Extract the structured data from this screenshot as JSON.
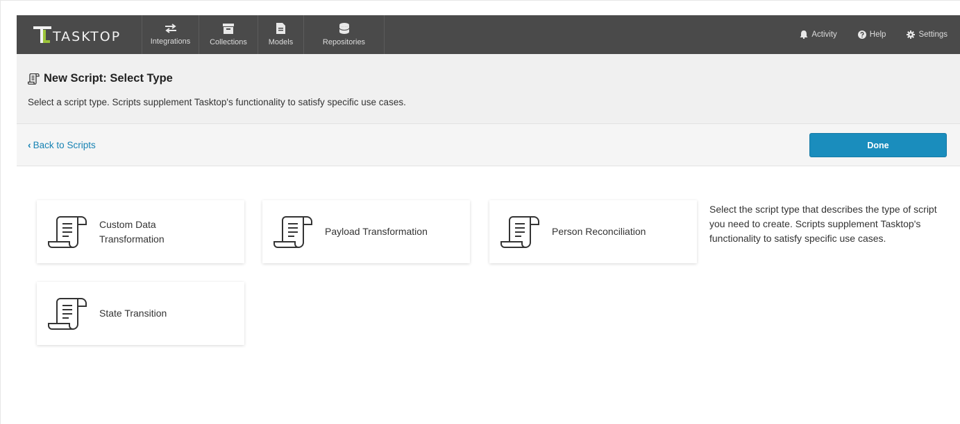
{
  "app": {
    "brand": "TASKTOP"
  },
  "nav": {
    "tabs": [
      {
        "label": "Integrations",
        "icon": "arrows-exchange-icon"
      },
      {
        "label": "Collections",
        "icon": "archive-box-icon"
      },
      {
        "label": "Models",
        "icon": "document-icon"
      },
      {
        "label": "Repositories",
        "icon": "database-icon"
      }
    ],
    "right": [
      {
        "label": "Activity",
        "icon": "bell-icon"
      },
      {
        "label": "Help",
        "icon": "question-circle-icon"
      },
      {
        "label": "Settings",
        "icon": "gear-icon"
      }
    ]
  },
  "header": {
    "title": "New Script: Select Type",
    "subtitle": "Select a script type. Scripts supplement Tasktop's functionality to satisfy specific use cases."
  },
  "actions": {
    "back_label": "Back to Scripts",
    "done_label": "Done"
  },
  "script_types": [
    {
      "label_line1": "Custom Data",
      "label_line2": "Transformation",
      "icon": "script-scroll-icon"
    },
    {
      "label_line1": "Payload Transformation",
      "label_line2": "",
      "icon": "script-scroll-icon"
    },
    {
      "label_line1": "Person Reconciliation",
      "label_line2": "",
      "icon": "script-scroll-icon"
    },
    {
      "label_line1": "State Transition",
      "label_line2": "",
      "icon": "script-scroll-icon"
    }
  ],
  "help_text": "Select the script type that describes the type of script you need to create. Scripts supplement Tasktop's functionality to satisfy specific use cases.",
  "colors": {
    "navbar": "#4a4a4a",
    "accent": "#1a8dbd",
    "link": "#1682b3",
    "brand_green": "#9cc43a"
  }
}
